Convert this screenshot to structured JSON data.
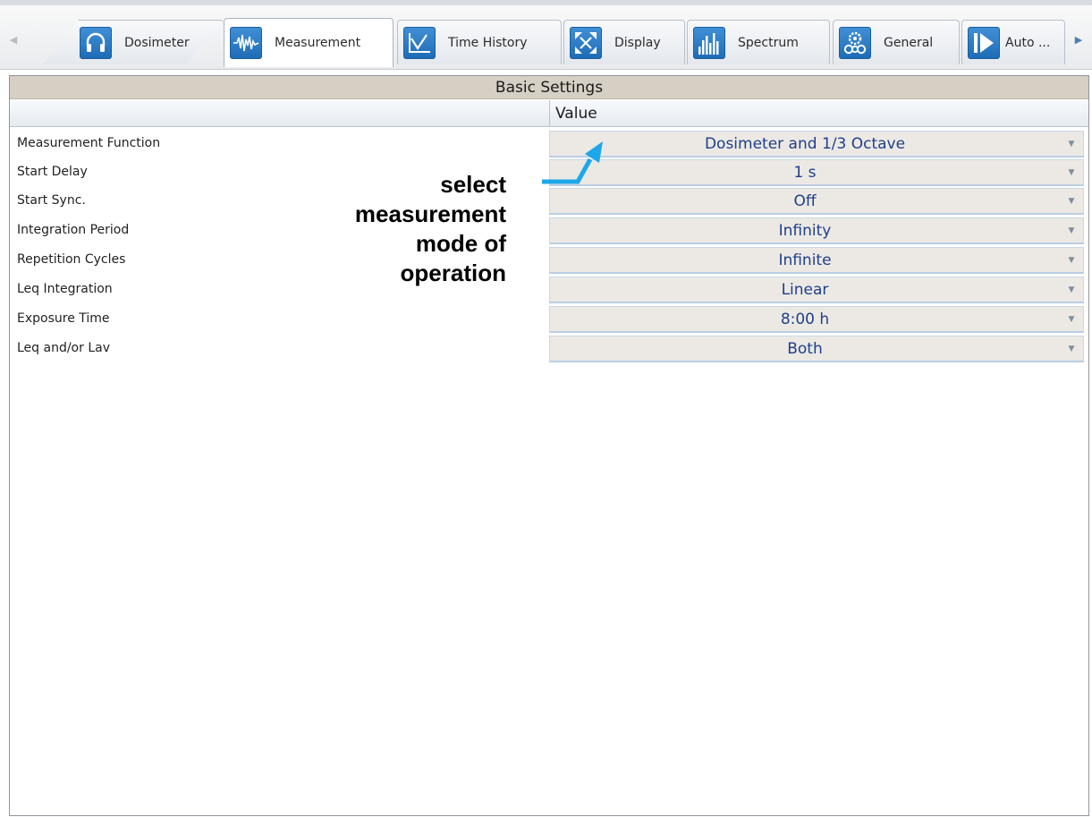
{
  "tabs": [
    {
      "label": "Dosimeter",
      "icon": "headphones-icon",
      "active": false
    },
    {
      "label": "Measurement",
      "icon": "waveform-icon",
      "active": true
    },
    {
      "label": "Time History",
      "icon": "line-graph-icon",
      "active": false
    },
    {
      "label": "Display",
      "icon": "expand-arrows-icon",
      "active": false
    },
    {
      "label": "Spectrum",
      "icon": "spectrum-bars-icon",
      "active": false
    },
    {
      "label": "General",
      "icon": "gears-icon",
      "active": false
    },
    {
      "label": "Auto ...",
      "icon": "play-icon",
      "active": false
    }
  ],
  "section": {
    "title": "Basic Settings"
  },
  "grid": {
    "value_header": "Value",
    "rows": [
      {
        "label": "Measurement Function",
        "value": "Dosimeter and 1/3 Octave"
      },
      {
        "label": "Start Delay",
        "value": "1 s"
      },
      {
        "label": "Start Sync.",
        "value": "Off"
      },
      {
        "label": "Integration Period",
        "value": "Infinity"
      },
      {
        "label": "Repetition Cycles",
        "value": "Infinite"
      },
      {
        "label": "Leq Integration",
        "value": "Linear"
      },
      {
        "label": "Exposure Time",
        "value": "8:00 h"
      },
      {
        "label": "Leq and/or Lav",
        "value": "Both"
      }
    ]
  },
  "annotation": {
    "lines": [
      "select",
      "measurement",
      "mode of",
      "operation"
    ]
  },
  "colors": {
    "accent_blue": "#2a7cc7",
    "value_text": "#1e3f8a",
    "arrow": "#1ea7e8",
    "header_bg": "#d6cfc4"
  }
}
